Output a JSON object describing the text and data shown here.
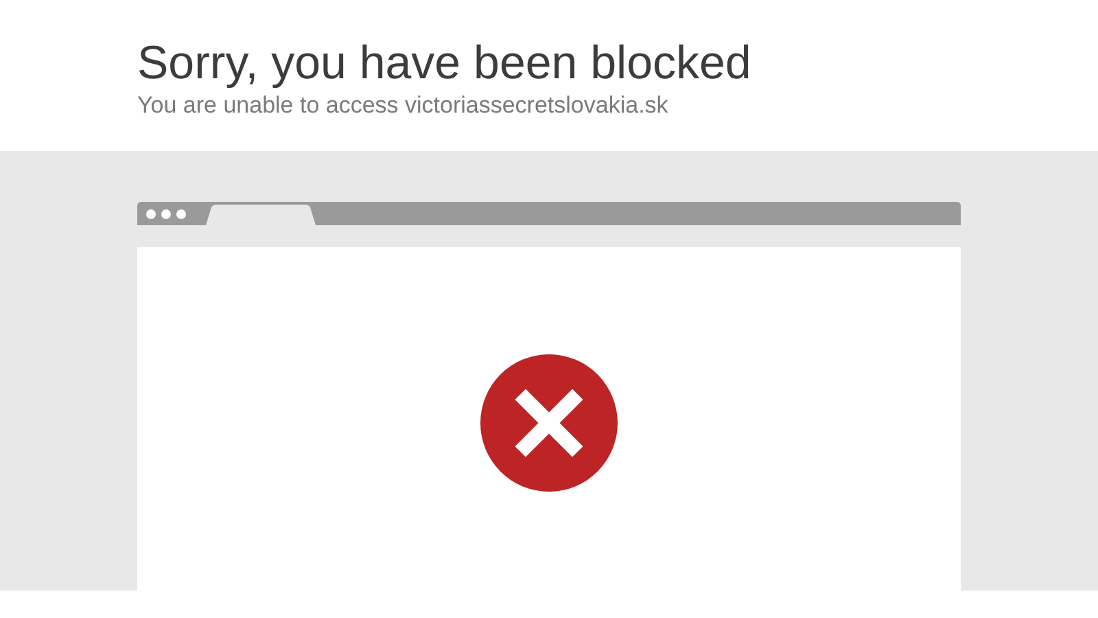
{
  "title": "Sorry, you have been blocked",
  "subtitle": "You are unable to access victoriassecretslovakia.sk"
}
